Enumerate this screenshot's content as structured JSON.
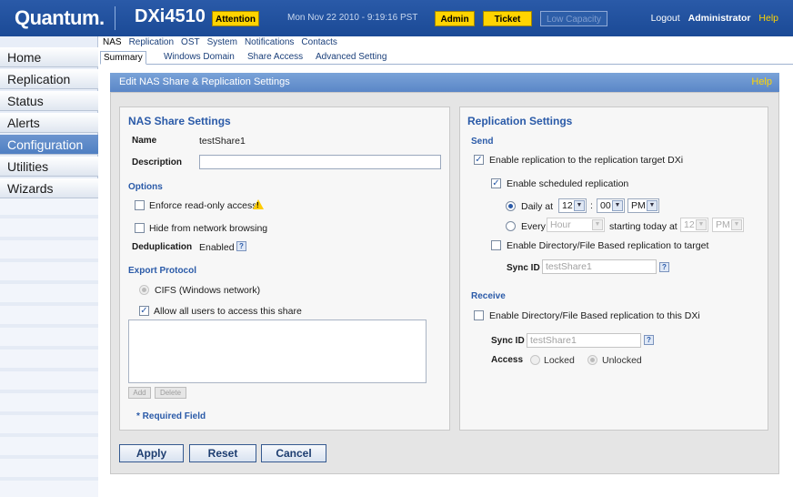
{
  "banner": {
    "logo": "Quantum.",
    "product": "DXi4510",
    "attention": "Attention",
    "datetime": "Mon Nov 22 2010 - 9:19:16 PST",
    "admin": "Admin",
    "ticket": "Ticket",
    "low_capacity": "Low Capacity",
    "logout": "Logout",
    "user": "Administrator",
    "help": "Help"
  },
  "leftnav": {
    "items": [
      "Home",
      "Replication",
      "Status",
      "Alerts",
      "Configuration",
      "Utilities",
      "Wizards"
    ],
    "active": "Configuration"
  },
  "tabs": {
    "primary": [
      "NAS",
      "Replication",
      "OST",
      "System",
      "Notifications",
      "Contacts"
    ],
    "secondary": [
      "Summary",
      "Windows Domain",
      "Share Access",
      "Advanced Setting"
    ]
  },
  "page": {
    "title": "Edit NAS Share & Replication Settings",
    "help": "Help"
  },
  "nas": {
    "heading": "NAS Share Settings",
    "name_label": "Name",
    "name_value": "testShare1",
    "description_label": "Description",
    "description_value": "",
    "options_heading": "Options",
    "readonly_label": "Enforce read-only access",
    "readonly_checked": false,
    "hide_label": "Hide from network browsing",
    "hide_checked": false,
    "dedup_label": "Deduplication",
    "dedup_value": "Enabled",
    "protocol_heading": "Export Protocol",
    "cifs_label": "CIFS (Windows network)",
    "allow_label": "Allow all users to access this share",
    "allow_checked": true,
    "add_label": "Add",
    "delete_label": "Delete",
    "required_note": "* Required Field"
  },
  "replication": {
    "heading": "Replication Settings",
    "send_heading": "Send",
    "enable_target_label": "Enable replication to the replication target DXi",
    "enable_target_checked": true,
    "scheduled_label": "Enable scheduled replication",
    "scheduled_checked": true,
    "daily_label": "Daily at",
    "daily_hour": "12",
    "daily_minute": "00",
    "daily_ampm": "PM",
    "every_label": "Every",
    "every_value": "Hour",
    "starting_label": "starting today at",
    "starting_hour": "12",
    "starting_ampm": "PM",
    "dir_target_label": "Enable Directory/File Based replication to target",
    "dir_target_checked": false,
    "sync_id_label": "Sync ID",
    "sync_id_value": "testShare1",
    "receive_heading": "Receive",
    "dir_receive_label": "Enable Directory/File Based replication to this DXi",
    "dir_receive_checked": false,
    "receive_sync_id_label": "Sync ID",
    "receive_sync_id_value": "testShare1",
    "access_label": "Access",
    "locked_label": "Locked",
    "unlocked_label": "Unlocked"
  },
  "actions": {
    "apply": "Apply",
    "reset": "Reset",
    "cancel": "Cancel"
  }
}
